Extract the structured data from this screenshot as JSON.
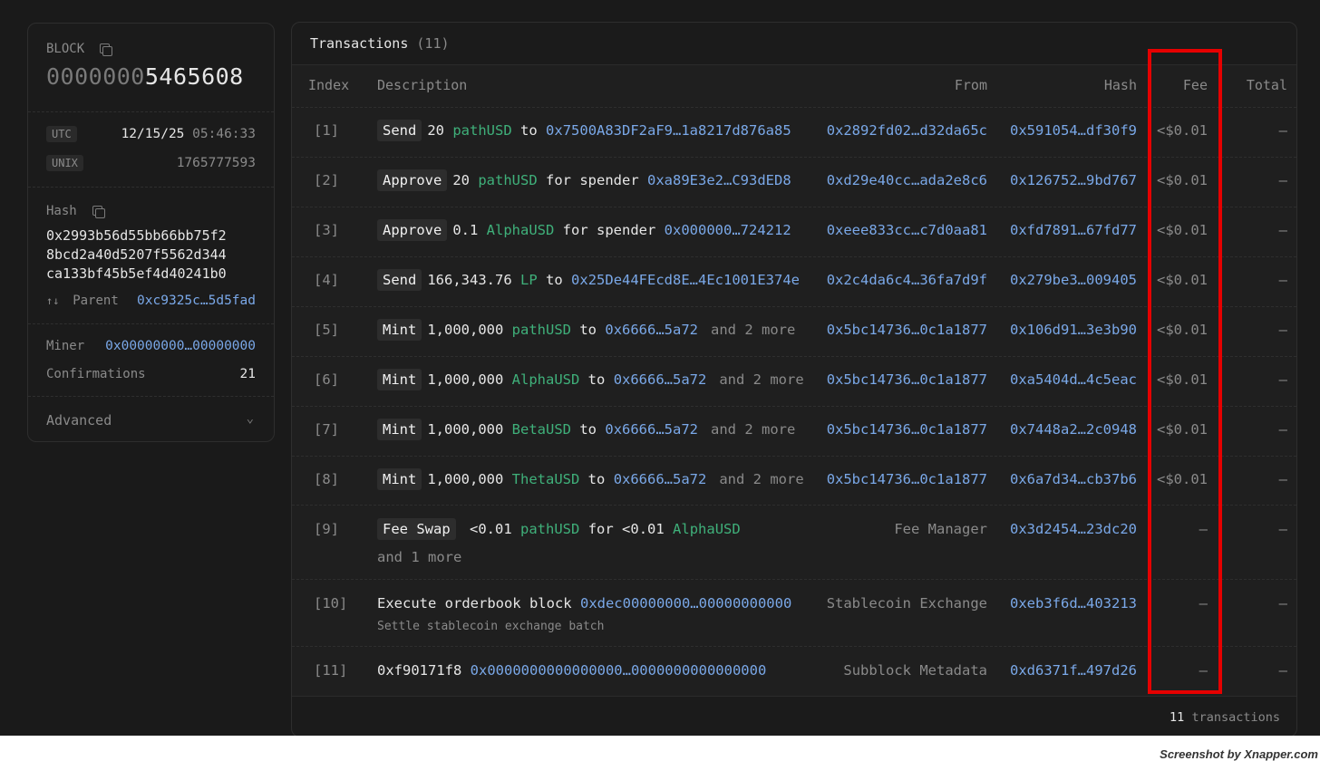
{
  "block": {
    "label": "BLOCK",
    "number_prefix": "0000000",
    "number_main": "5465608",
    "utc_tag": "UTC",
    "utc_date": "12/15/25",
    "utc_time": "05:46:33",
    "unix_tag": "UNIX",
    "unix_value": "1765777593",
    "hash_label": "Hash",
    "hash_lines": [
      "0x2993b56d55bb66bb75f2",
      "8bcd2a40d5207f5562d344",
      "ca133bf45b5ef4d40241b0"
    ],
    "parent_label": "Parent",
    "parent_value": "0xc9325c…5d5fad",
    "miner_label": "Miner",
    "miner_value": "0x00000000…00000000",
    "confirmations_label": "Confirmations",
    "confirmations_value": "21",
    "advanced_label": "Advanced"
  },
  "transactions": {
    "title": "Transactions",
    "count": "(11)",
    "columns": {
      "index": "Index",
      "description": "Description",
      "from": "From",
      "hash": "Hash",
      "fee": "Fee",
      "total": "Total"
    },
    "rows": [
      {
        "index": "[1]",
        "kw": "Send",
        "amount": "20",
        "token": "pathUSD",
        "mid": "to",
        "addr": "0x7500A83DF2aF9…1a8217d876a85",
        "from": "0x2892fd02…d32da65c",
        "hash": "0x591054…df30f9",
        "fee": "<$0.01",
        "total": "—"
      },
      {
        "index": "[2]",
        "kw": "Approve",
        "amount": "20",
        "token": "pathUSD",
        "mid": "for spender",
        "addr": "0xa89E3e2…C93dED8",
        "from": "0xd29e40cc…ada2e8c6",
        "hash": "0x126752…9bd767",
        "fee": "<$0.01",
        "total": "—"
      },
      {
        "index": "[3]",
        "kw": "Approve",
        "amount": "0.1",
        "token": "AlphaUSD",
        "mid": "for spender",
        "addr": "0x000000…724212",
        "from": "0xeee833cc…c7d0aa81",
        "hash": "0xfd7891…67fd77",
        "fee": "<$0.01",
        "total": "—"
      },
      {
        "index": "[4]",
        "kw": "Send",
        "amount": "166,343.76",
        "token": "LP",
        "mid": "to",
        "addr": "0x25De44FEcd8E…4Ec1001E374e",
        "from": "0x2c4da6c4…36fa7d9f",
        "hash": "0x279be3…009405",
        "fee": "<$0.01",
        "total": "—"
      },
      {
        "index": "[5]",
        "kw": "Mint",
        "amount": "1,000,000",
        "token": "pathUSD",
        "mid": "to",
        "addr": "0x6666…5a72",
        "more": "and 2 more",
        "from": "0x5bc14736…0c1a1877",
        "hash": "0x106d91…3e3b90",
        "fee": "<$0.01",
        "total": "—"
      },
      {
        "index": "[6]",
        "kw": "Mint",
        "amount": "1,000,000",
        "token": "AlphaUSD",
        "mid": "to",
        "addr": "0x6666…5a72",
        "more": "and 2 more",
        "from": "0x5bc14736…0c1a1877",
        "hash": "0xa5404d…4c5eac",
        "fee": "<$0.01",
        "total": "—"
      },
      {
        "index": "[7]",
        "kw": "Mint",
        "amount": "1,000,000",
        "token": "BetaUSD",
        "mid": "to",
        "addr": "0x6666…5a72",
        "more": "and 2 more",
        "from": "0x5bc14736…0c1a1877",
        "hash": "0x7448a2…2c0948",
        "fee": "<$0.01",
        "total": "—"
      },
      {
        "index": "[8]",
        "kw": "Mint",
        "amount": "1,000,000",
        "token": "ThetaUSD",
        "mid": "to",
        "addr": "0x6666…5a72",
        "more": "and 2 more",
        "from": "0x5bc14736…0c1a1877",
        "hash": "0x6a7d34…cb37b6",
        "fee": "<$0.01",
        "total": "—"
      }
    ],
    "row9": {
      "index": "[9]",
      "kw": "Fee Swap",
      "amount1": "<0.01",
      "token1": "pathUSD",
      "mid": "for",
      "amount2": "<0.01",
      "token2": "AlphaUSD",
      "more": "and 1 more",
      "from": "Fee Manager",
      "hash": "0x3d2454…23dc20",
      "fee": "—",
      "total": "—"
    },
    "row10": {
      "index": "[10]",
      "text": "Execute orderbook block",
      "addr": "0xdec00000000…00000000000",
      "sub": "Settle stablecoin exchange batch",
      "from": "Stablecoin Exchange",
      "hash": "0xeb3f6d…403213",
      "fee": "—",
      "total": "—"
    },
    "row11": {
      "index": "[11]",
      "text": "0xf90171f8",
      "addr": "0x0000000000000000…0000000000000000",
      "from": "Subblock Metadata",
      "hash": "0xd6371f…497d26",
      "fee": "—",
      "total": "—"
    },
    "footer_count": "11",
    "footer_label": "transactions"
  },
  "watermark": "Screenshot by Xnapper.com",
  "colors": {
    "link": "#7aa8e8",
    "token": "#3fb07a",
    "highlight": "#e60000"
  }
}
